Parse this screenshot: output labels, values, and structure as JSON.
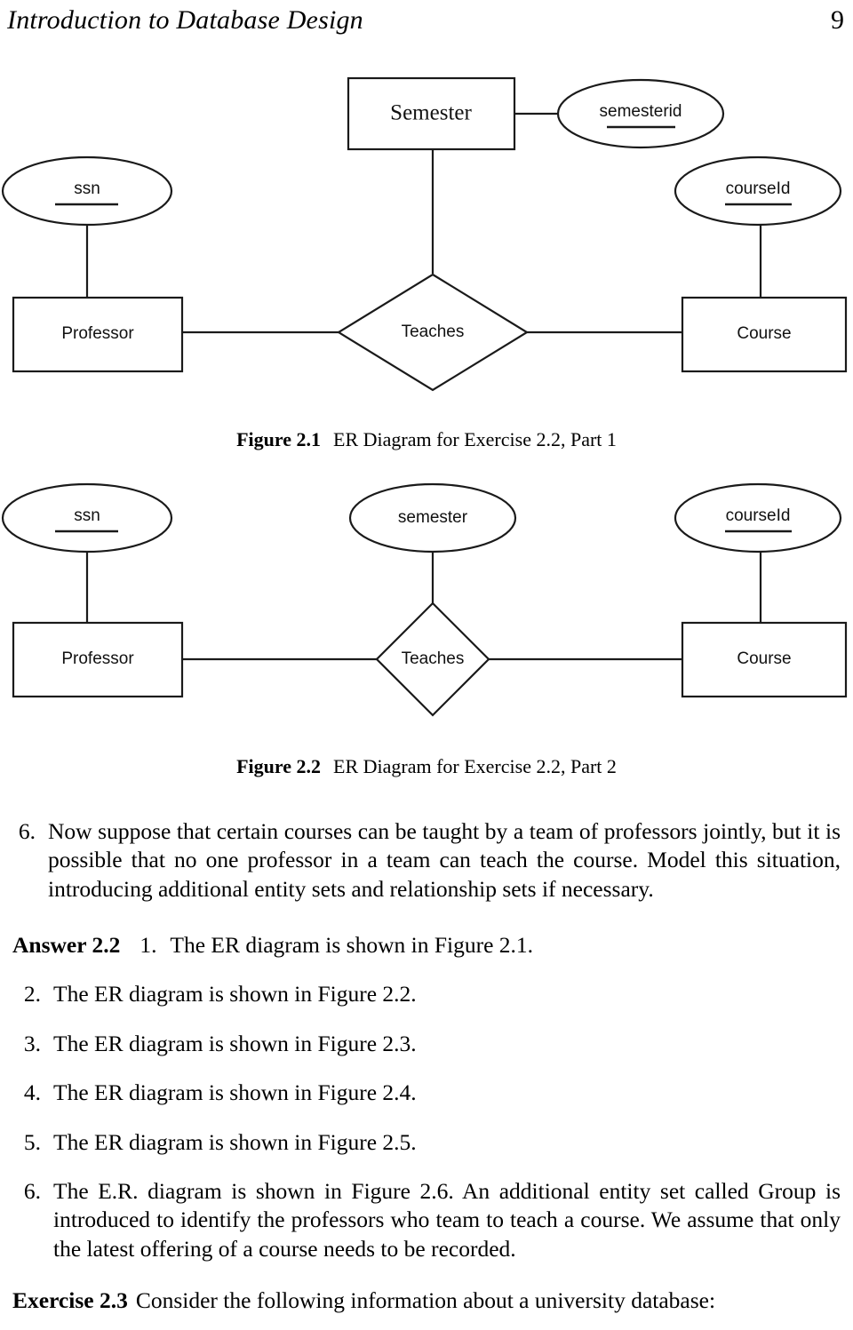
{
  "header": {
    "title": "Introduction to Database Design",
    "page_number": "9"
  },
  "figures": [
    {
      "id": "figure-1",
      "caption_label": "Figure 2.1",
      "caption_text": "ER Diagram for Exercise 2.2, Part 1",
      "entities": [
        {
          "name": "Semester",
          "type": "entity-box"
        },
        {
          "name": "Professor",
          "type": "entity-box"
        },
        {
          "name": "Course",
          "type": "entity-box"
        }
      ],
      "attributes": [
        {
          "name": "semesterid",
          "key": true
        },
        {
          "name": "ssn",
          "key": true
        },
        {
          "name": "courseId",
          "key": true
        }
      ],
      "relationships": [
        {
          "name": "Teaches",
          "type": "diamond"
        }
      ]
    },
    {
      "id": "figure-2",
      "caption_label": "Figure 2.2",
      "caption_text": "ER Diagram for Exercise 2.2, Part 2",
      "entities": [
        {
          "name": "Professor",
          "type": "entity-box"
        },
        {
          "name": "Course",
          "type": "entity-box"
        }
      ],
      "attributes": [
        {
          "name": "ssn",
          "key": true
        },
        {
          "name": "semester",
          "key": false
        },
        {
          "name": "courseId",
          "key": true
        }
      ],
      "relationships": [
        {
          "name": "Teaches",
          "type": "diamond"
        }
      ]
    }
  ],
  "question": {
    "marker": "6.",
    "text": "Now suppose that certain courses can be taught by a team of professors jointly, but it is possible that no one professor in a team can teach the course. Model this situation, introducing additional entity sets and relationship sets if necessary."
  },
  "answer": {
    "label": "Answer 2.2",
    "items": [
      {
        "marker": "1.",
        "text": "The ER diagram is shown in Figure 2.1."
      },
      {
        "marker": "2.",
        "text": "The ER diagram is shown in Figure 2.2."
      },
      {
        "marker": "3.",
        "text": "The ER diagram is shown in Figure 2.3."
      },
      {
        "marker": "4.",
        "text": "The ER diagram is shown in Figure 2.4."
      },
      {
        "marker": "5.",
        "text": "The ER diagram is shown in Figure 2.5."
      },
      {
        "marker": "6.",
        "text": "The E.R. diagram is shown in Figure 2.6. An additional entity set called Group is introduced to identify the professors who team to teach a course. We assume that only the latest offering of a course needs to be recorded."
      }
    ]
  },
  "exercise": {
    "label": "Exercise 2.3",
    "text": "Consider the following information about a university database:"
  }
}
